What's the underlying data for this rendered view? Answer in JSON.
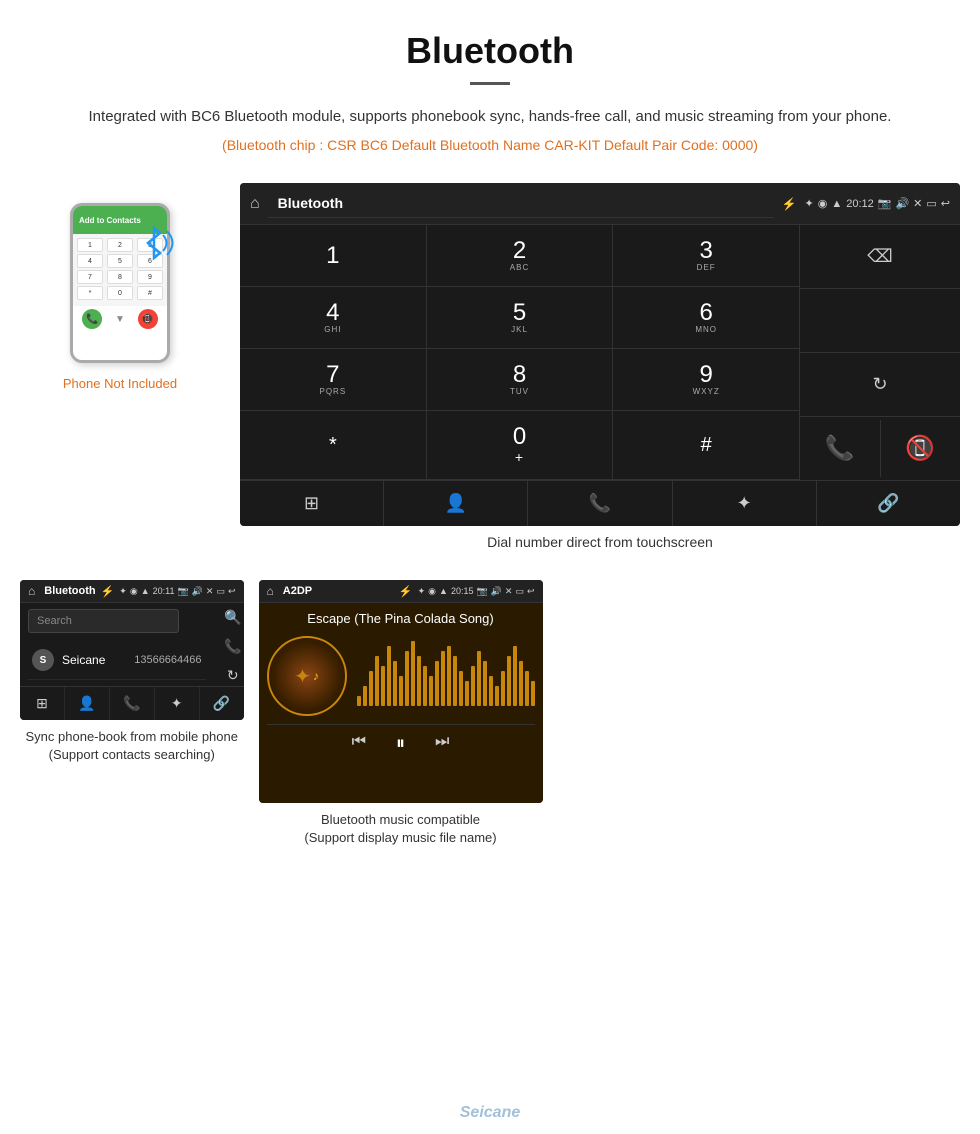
{
  "page": {
    "title": "Bluetooth",
    "description": "Integrated with BC6 Bluetooth module, supports phonebook sync, hands-free call, and music streaming from your phone.",
    "specs": "(Bluetooth chip : CSR BC6    Default Bluetooth Name CAR-KIT    Default Pair Code: 0000)",
    "phone_not_included": "Phone Not Included",
    "dial_label": "Dial number direct from touchscreen",
    "phonebook_label_line1": "Sync phone-book from mobile phone",
    "phonebook_label_line2": "(Support contacts searching)",
    "music_label_line1": "Bluetooth music compatible",
    "music_label_line2": "(Support display music file name)"
  },
  "dialer_screen": {
    "header_title": "Bluetooth",
    "time": "20:12",
    "keys": [
      {
        "digit": "1",
        "sub": ""
      },
      {
        "digit": "2",
        "sub": "ABC"
      },
      {
        "digit": "3",
        "sub": "DEF"
      },
      {
        "digit": "4",
        "sub": "GHI"
      },
      {
        "digit": "5",
        "sub": "JKL"
      },
      {
        "digit": "6",
        "sub": "MNO"
      },
      {
        "digit": "7",
        "sub": "PQRS"
      },
      {
        "digit": "8",
        "sub": "TUV"
      },
      {
        "digit": "9",
        "sub": "WXYZ"
      },
      {
        "digit": "*",
        "sub": ""
      },
      {
        "digit": "0",
        "sub": "+"
      },
      {
        "digit": "#",
        "sub": ""
      }
    ]
  },
  "phonebook_screen": {
    "header_title": "Bluetooth",
    "time": "20:11",
    "search_placeholder": "Search",
    "contact_name": "Seicane",
    "contact_letter": "S",
    "contact_phone": "13566664466"
  },
  "music_screen": {
    "header_title": "A2DP",
    "time": "20:15",
    "song_title": "Escape (The Pina Colada Song)",
    "viz_heights": [
      10,
      20,
      35,
      50,
      40,
      60,
      45,
      30,
      55,
      65,
      50,
      40,
      30,
      45,
      55,
      60,
      50,
      35,
      25,
      40,
      55,
      45,
      30,
      20,
      35,
      50,
      60,
      45,
      35,
      25
    ]
  },
  "phone_screen": {
    "add_contacts_label": "Add to Contacts",
    "keypad_rows": [
      [
        "1",
        "2",
        "3"
      ],
      [
        "4",
        "5",
        "6"
      ],
      [
        "7",
        "8",
        "9"
      ],
      [
        "*",
        "0",
        "#"
      ]
    ]
  }
}
